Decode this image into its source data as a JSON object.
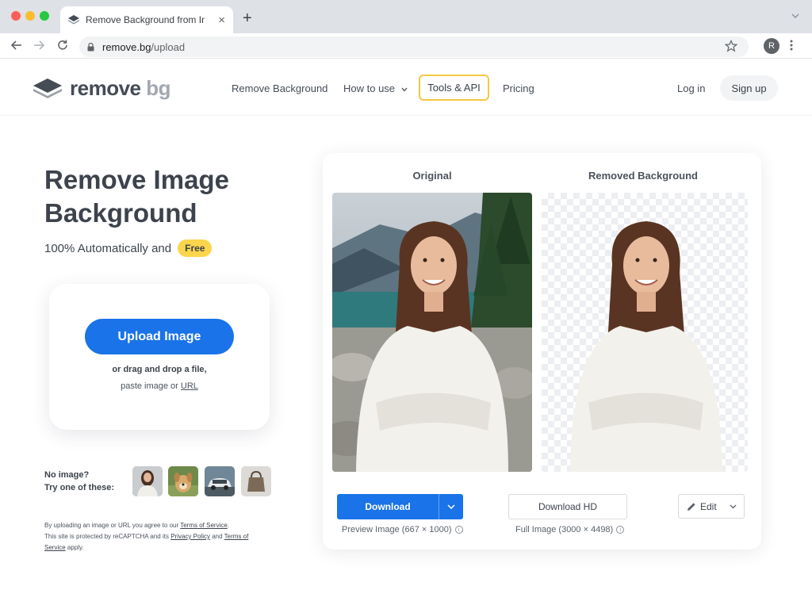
{
  "browser": {
    "tab_title": "Remove Background from Image",
    "url_host": "remove.bg",
    "url_path": "/upload",
    "profile_initial": "R",
    "traffic_colors": [
      "#ff5f57",
      "#febc2e",
      "#28c840"
    ]
  },
  "header": {
    "logo_main": "remove",
    "logo_accent": "bg",
    "nav": {
      "remove_background": "Remove Background",
      "how_to_use": "How to use",
      "tools_api": "Tools & API",
      "pricing": "Pricing"
    },
    "login": "Log in",
    "signup": "Sign up"
  },
  "hero": {
    "title": "Remove Image Background",
    "subtitle": "100% Automatically and",
    "badge": "Free"
  },
  "upload": {
    "button": "Upload Image",
    "drag_text": "or drag and drop a file,",
    "paste_text": "paste image or",
    "url_link": "URL"
  },
  "samples": {
    "line1": "No image?",
    "line2": "Try one of these:",
    "items": [
      "woman-sample",
      "dog-sample",
      "car-sample",
      "bag-sample"
    ]
  },
  "legal": {
    "part1": "By uploading an image or URL you agree to our",
    "tos": "Terms of Service",
    "part2": "This site is protected by reCAPTCHA and its",
    "privacy": "Privacy Policy",
    "and": "and",
    "tos2a": "Terms of",
    "tos2b": "Service",
    "apply": "apply."
  },
  "preview": {
    "original_label": "Original",
    "removed_label": "Removed Background",
    "download": "Download",
    "download_hd": "Download HD",
    "edit": "Edit",
    "preview_caption": "Preview Image (667 × 1000)",
    "full_caption": "Full Image (3000 × 4498)"
  },
  "colors": {
    "accent": "#1a73e8",
    "badge": "#fbd54c",
    "tools_border": "#f5c842"
  }
}
